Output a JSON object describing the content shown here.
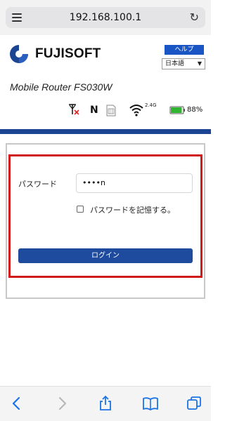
{
  "browser": {
    "url": "192.168.100.1"
  },
  "header": {
    "brand": "FUJISOFT",
    "help_label": "ヘルプ",
    "language_selected": "日本語",
    "model": "Mobile Router FS030W"
  },
  "status": {
    "network_mode": "N",
    "wifi_band": "2.4G",
    "battery_percent": "88%",
    "icons": [
      "antenna-no-signal-icon",
      "sim-icon",
      "wifi-icon",
      "battery-icon"
    ]
  },
  "login": {
    "password_label": "パスワード",
    "password_value": "••••n",
    "remember_label": "パスワードを記憶する。",
    "remember_checked": false,
    "login_label": "ログイン"
  },
  "colors": {
    "brand_blue": "#1b4593",
    "help_blue": "#1a55c5",
    "highlight_red": "#d21a1a",
    "battery_green": "#2fb52f"
  }
}
